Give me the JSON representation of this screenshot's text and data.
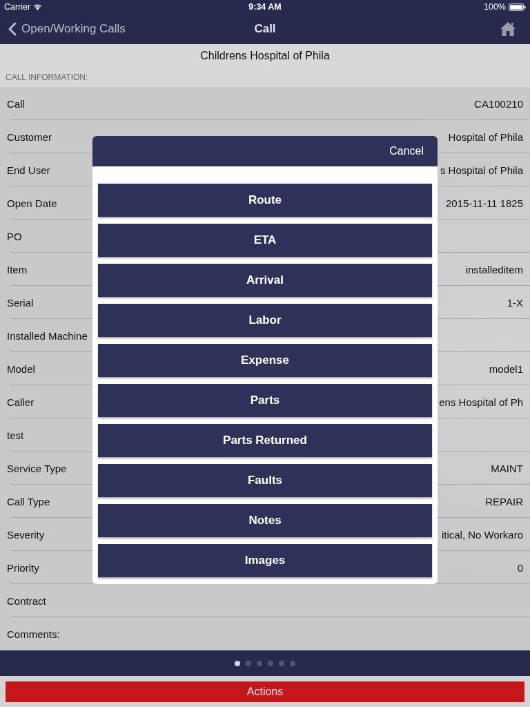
{
  "status_bar": {
    "carrier": "Carrier",
    "time": "9:34 AM",
    "battery": "100%"
  },
  "nav_bar": {
    "back": "Open/Working Calls",
    "title": "Call"
  },
  "header": {
    "title": "Childrens Hospital of Phila",
    "section": "CALL INFORMATION:"
  },
  "fields": [
    {
      "label": "Call",
      "value": "CA100210"
    },
    {
      "label": "Customer",
      "value": "Hospital of Phila"
    },
    {
      "label": "End User",
      "value": "s Hospital of Phila"
    },
    {
      "label": "Open Date",
      "value": "2015-11-11 1825"
    },
    {
      "label": "PO"
    },
    {
      "label": "Item",
      "value": "installeditem"
    },
    {
      "label": "Serial",
      "value": "1-X"
    },
    {
      "label": "Installed Machine"
    },
    {
      "label": "Model",
      "value": "model1"
    },
    {
      "label": "Caller",
      "value": "ens Hospital of Ph"
    },
    {
      "label": "test"
    },
    {
      "label": "Service Type",
      "value": "MAINT"
    },
    {
      "label": "Call Type",
      "value": "REPAIR"
    },
    {
      "label": "Severity",
      "value": "itical, No Workaro"
    },
    {
      "label": "Priority",
      "value": "0"
    },
    {
      "label": "Contract"
    },
    {
      "label": "Comments:"
    }
  ],
  "action_sheet": {
    "cancel": "Cancel",
    "actions": [
      "Route",
      "ETA",
      "Arrival",
      "Labor",
      "Expense",
      "Parts",
      "Parts Returned",
      "Faults",
      "Notes",
      "Images"
    ]
  },
  "pager": {
    "dots": [
      {
        "selected": true
      },
      {
        "selected": false
      },
      {
        "selected": false
      },
      {
        "selected": false
      },
      {
        "selected": false
      },
      {
        "selected": false
      }
    ]
  },
  "footer": {
    "button": "Actions"
  }
}
